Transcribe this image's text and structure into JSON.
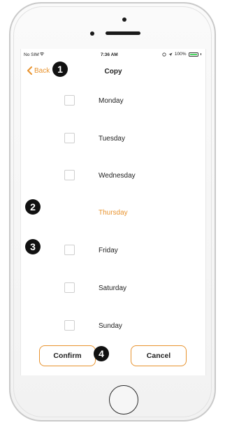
{
  "status_bar": {
    "carrier": "No SIM",
    "time": "7:36 AM",
    "battery": "100%"
  },
  "nav": {
    "back_label": "Back",
    "title": "Copy"
  },
  "days": [
    {
      "label": "Monday",
      "checked": false,
      "is_current": false
    },
    {
      "label": "Tuesday",
      "checked": false,
      "is_current": false
    },
    {
      "label": "Wednesday",
      "checked": false,
      "is_current": false
    },
    {
      "label": "Thursday",
      "checked": false,
      "is_current": true
    },
    {
      "label": "Friday",
      "checked": false,
      "is_current": false
    },
    {
      "label": "Saturday",
      "checked": false,
      "is_current": false
    },
    {
      "label": "Sunday",
      "checked": false,
      "is_current": false
    }
  ],
  "buttons": {
    "confirm": "Confirm",
    "cancel": "Cancel"
  },
  "callouts": [
    "1",
    "2",
    "3",
    "4"
  ],
  "colors": {
    "accent": "#e8932e",
    "text": "#222222",
    "checkbox_border": "#cfcfcf",
    "battery": "#4cd964"
  }
}
